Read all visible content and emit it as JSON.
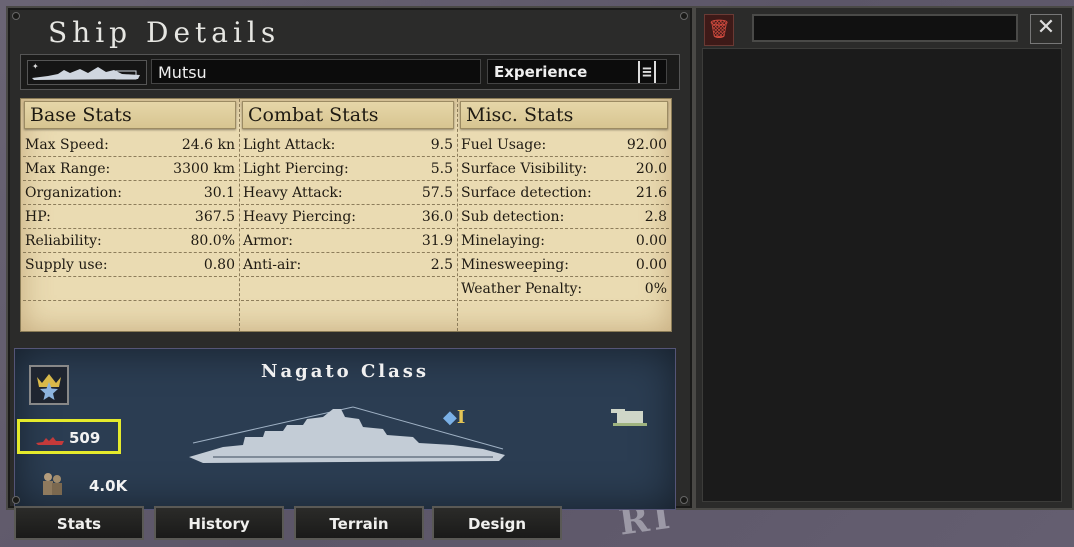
{
  "window": {
    "title": "Ship Details"
  },
  "ship": {
    "name": "Mutsu",
    "experience_label": "Experience"
  },
  "stats": {
    "base": {
      "header": "Base Stats",
      "rows": [
        {
          "label": "Max Speed:",
          "value": "24.6 kn"
        },
        {
          "label": "Max Range:",
          "value": "3300 km"
        },
        {
          "label": "Organization:",
          "value": "30.1"
        },
        {
          "label": "HP:",
          "value": "367.5"
        },
        {
          "label": "Reliability:",
          "value": "80.0%"
        },
        {
          "label": "Supply use:",
          "value": "0.80"
        }
      ]
    },
    "combat": {
      "header": "Combat Stats",
      "rows": [
        {
          "label": "Light Attack:",
          "value": "9.5"
        },
        {
          "label": "Light Piercing:",
          "value": "5.5"
        },
        {
          "label": "Heavy Attack:",
          "value": "57.5"
        },
        {
          "label": "Heavy Piercing:",
          "value": "36.0"
        },
        {
          "label": "Armor:",
          "value": "31.9"
        },
        {
          "label": "Anti-air:",
          "value": "2.5"
        }
      ]
    },
    "misc": {
      "header": "Misc. Stats",
      "rows": [
        {
          "label": "Fuel Usage:",
          "value": "92.00"
        },
        {
          "label": "Surface Visibility:",
          "value": "20.0"
        },
        {
          "label": "Surface detection:",
          "value": "21.6"
        },
        {
          "label": "Sub detection:",
          "value": "2.8"
        },
        {
          "label": "Minelaying:",
          "value": "0.00"
        },
        {
          "label": "Minesweeping:",
          "value": "0.00"
        },
        {
          "label": "Weather Penalty:",
          "value": "0%"
        }
      ]
    }
  },
  "card": {
    "class_title": "Nagato Class",
    "ship_count": "509",
    "manpower": "4.0K",
    "upgrade_label": "I",
    "accent_color": "#e5ea2c"
  },
  "tabs": [
    "Stats",
    "History",
    "Terrain",
    "Design"
  ],
  "icons": {
    "trash": "trash-icon",
    "close": "close-icon",
    "star": "star-crown-icon",
    "ship": "ship-icon",
    "gun": "gun-turret-icon",
    "manpower": "manpower-icon",
    "experience": "experience-icon"
  },
  "right_panel": {
    "close_symbol": "✕",
    "trash_symbol": "🗑"
  }
}
